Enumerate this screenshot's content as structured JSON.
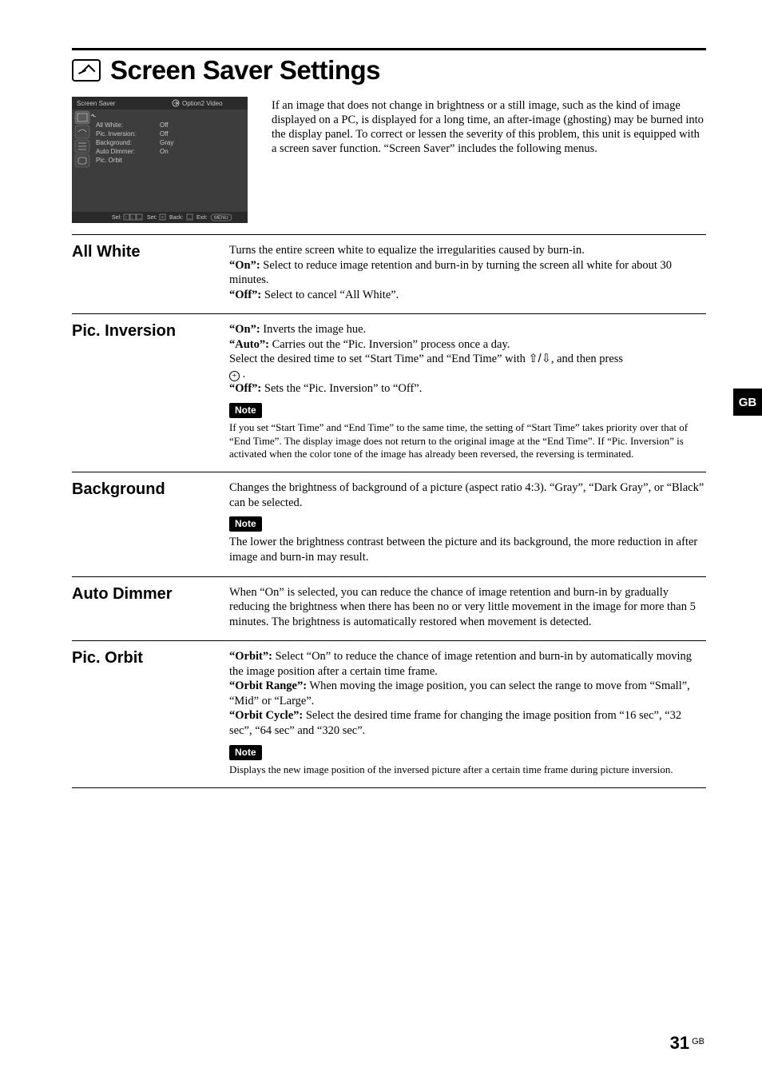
{
  "page": {
    "title": "Screen Saver Settings",
    "intro": "If an image that does not change in brightness or a still image, such as the kind of image displayed on a PC, is displayed for a long time, an after-image (ghosting) may be burned into the display panel. To correct or lessen the severity of this problem, this unit is equipped with a screen saver function. “Screen Saver” includes the following menus.",
    "region": "GB",
    "number": "31",
    "number_suffix": "GB"
  },
  "screenshot": {
    "title": "Screen Saver",
    "source": "Option2 Video",
    "rows": [
      {
        "label": "All White:",
        "value": "Off"
      },
      {
        "label": "Pic. Inversion:",
        "value": "Off"
      },
      {
        "label": "Background:",
        "value": "Gray"
      },
      {
        "label": "Auto Dimmer:",
        "value": "On"
      },
      {
        "label": "Pic. Orbit",
        "value": ""
      }
    ],
    "footer": {
      "sel": "Sel:",
      "set": "Set:",
      "back": "Back:",
      "exit": "Exit:",
      "menu": "MENU"
    }
  },
  "sections": [
    {
      "heading": "All White",
      "body": [
        {
          "t": "plain",
          "text": "Turns the entire screen white to equalize the irregularities caused by burn-in."
        },
        {
          "t": "kv",
          "key": "“On”:",
          "text": " Select to reduce image retention and burn-in by turning the screen all white for about 30 minutes."
        },
        {
          "t": "kv",
          "key": "“Off”:",
          "text": " Select to cancel “All White”."
        }
      ]
    },
    {
      "heading": "Pic. Inversion",
      "body": [
        {
          "t": "kv",
          "key": "“On”:",
          "text": " Inverts the image hue."
        },
        {
          "t": "kv",
          "key": "“Auto”:",
          "text": " Carries out the “Pic. Inversion” process once a day."
        },
        {
          "t": "sel_line",
          "pre": "Select the desired time to set “Start Time” and “End Time” with ",
          "post": ", and then press "
        },
        {
          "t": "kv",
          "key": "“Off”:",
          "text": " Sets the “Pic. Inversion” to “Off”."
        }
      ],
      "note": {
        "label": "Note",
        "text": "If you set “Start Time” and “End Time” to the same time, the setting of “Start Time” takes priority over that of “End Time”. The display image does not return to the original image at the “End Time”. If “Pic. Inversion” is activated when the color tone of the image has already been reversed, the reversing is terminated."
      }
    },
    {
      "heading": "Background",
      "body": [
        {
          "t": "plain",
          "text": "Changes the brightness of background of a picture (aspect ratio 4:3). “Gray”, “Dark Gray”, or “Black” can be selected."
        }
      ],
      "note": {
        "label": "Note",
        "text": "The lower the brightness contrast between the picture and its background, the more reduction in after image and burn-in may result."
      }
    },
    {
      "heading": "Auto Dimmer",
      "body": [
        {
          "t": "plain",
          "text": "When “On” is selected, you can reduce the chance of image retention and burn-in by gradually reducing the brightness when there has been no or very little movement in the image for more than 5 minutes. The brightness is automatically restored when movement is detected."
        }
      ]
    },
    {
      "heading": "Pic. Orbit",
      "body": [
        {
          "t": "kv",
          "key": "“Orbit”:",
          "text": " Select “On” to reduce the chance of image retention and burn-in by automatically moving the image position after a certain time frame."
        },
        {
          "t": "kv",
          "key": "“Orbit Range”:",
          "text": " When moving the image position, you can select the range to move from “Small”, “Mid” or “Large”."
        },
        {
          "t": "kv",
          "key": "“Orbit Cycle”:",
          "text": " Select the desired time frame for changing the image position from “16 sec”, “32 sec”, “64 sec” and “320 sec”."
        }
      ],
      "note": {
        "label": "Note",
        "text": "Displays the new image position of the inversed picture after a certain time frame during picture inversion."
      }
    }
  ]
}
